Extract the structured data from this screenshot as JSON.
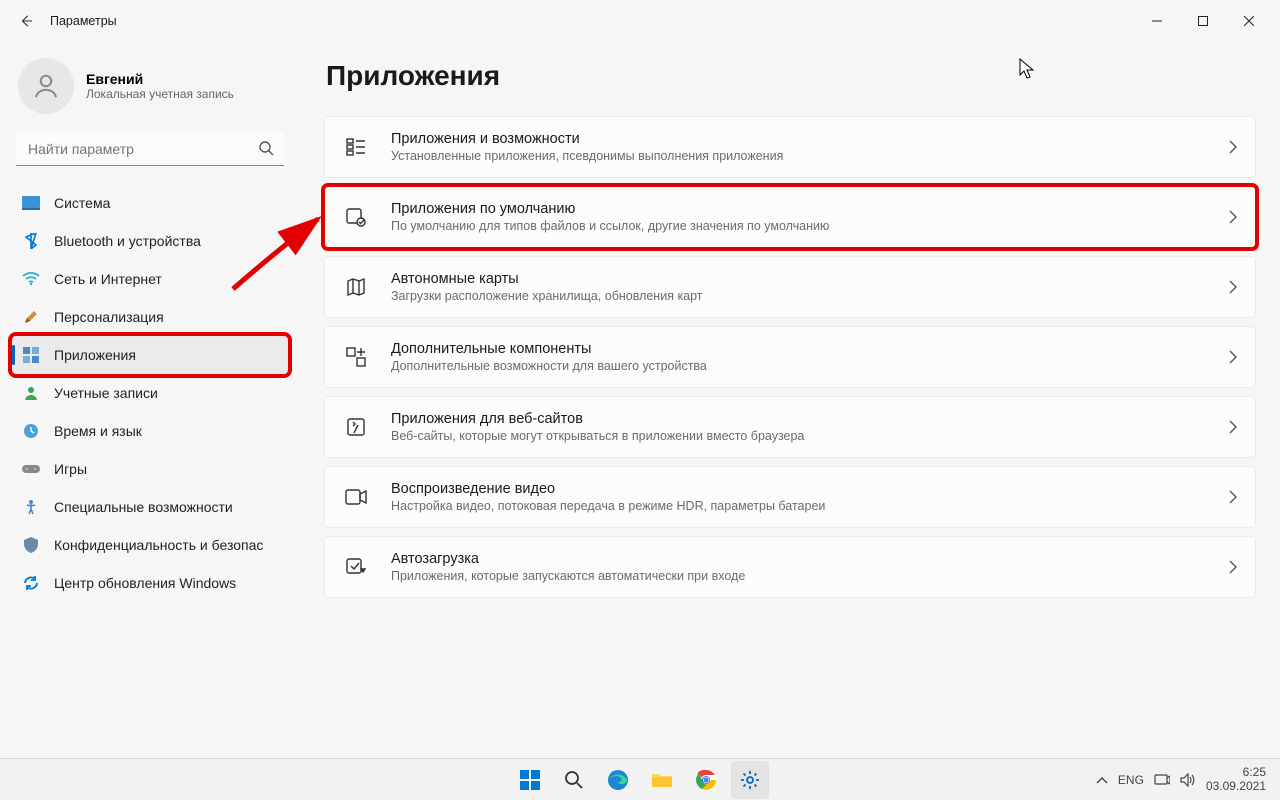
{
  "window": {
    "title": "Параметры"
  },
  "user": {
    "name": "Евгений",
    "subtitle": "Локальная учетная запись"
  },
  "search": {
    "placeholder": "Найти параметр"
  },
  "nav": {
    "items": [
      {
        "label": "Система",
        "icon": "system"
      },
      {
        "label": "Bluetooth и устройства",
        "icon": "bluetooth"
      },
      {
        "label": "Сеть и Интернет",
        "icon": "wifi"
      },
      {
        "label": "Персонализация",
        "icon": "personalize"
      },
      {
        "label": "Приложения",
        "icon": "apps"
      },
      {
        "label": "Учетные записи",
        "icon": "accounts"
      },
      {
        "label": "Время и язык",
        "icon": "time"
      },
      {
        "label": "Игры",
        "icon": "gaming"
      },
      {
        "label": "Специальные возможности",
        "icon": "accessibility"
      },
      {
        "label": "Конфиденциальность и безопас",
        "icon": "privacy"
      },
      {
        "label": "Центр обновления Windows",
        "icon": "update"
      }
    ],
    "active_index": 4
  },
  "page": {
    "title": "Приложения"
  },
  "cards": [
    {
      "title": "Приложения и возможности",
      "subtitle": "Установленные приложения, псевдонимы выполнения приложения"
    },
    {
      "title": "Приложения по умолчанию",
      "subtitle": "По умолчанию для типов файлов и ссылок, другие значения по умолчанию"
    },
    {
      "title": "Автономные карты",
      "subtitle": "Загрузки расположение хранилища, обновления карт"
    },
    {
      "title": "Дополнительные компоненты",
      "subtitle": "Дополнительные возможности для вашего устройства"
    },
    {
      "title": "Приложения для веб-сайтов",
      "subtitle": "Веб-сайты, которые могут открываться в приложении вместо браузера"
    },
    {
      "title": "Воспроизведение видео",
      "subtitle": "Настройка видео, потоковая передача в режиме HDR, параметры батареи"
    },
    {
      "title": "Автозагрузка",
      "subtitle": "Приложения, которые запускаются автоматически при входе"
    }
  ],
  "highlight": {
    "nav_index": 4,
    "card_index": 1
  },
  "taskbar": {
    "lang": "ENG",
    "time": "6:25",
    "date": "03.09.2021"
  }
}
